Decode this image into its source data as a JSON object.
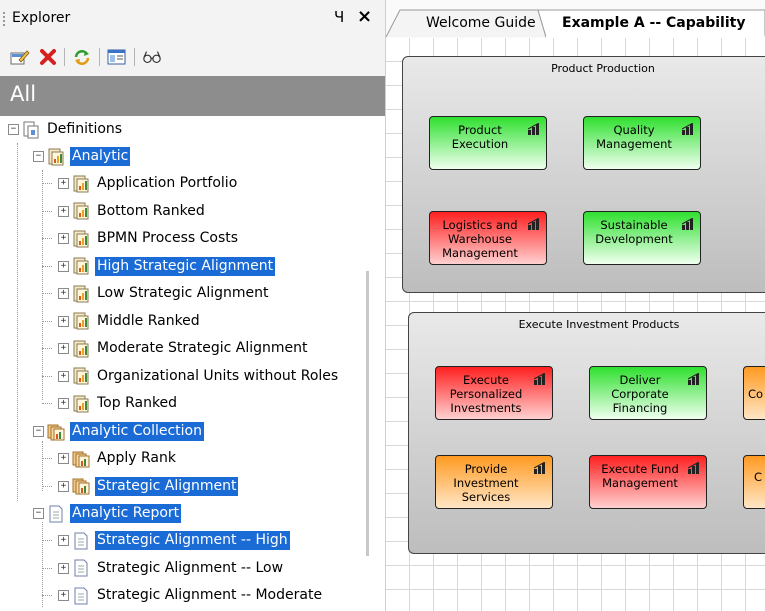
{
  "explorer": {
    "title": "Explorer",
    "pin_glyph": "Ч",
    "close_glyph": "×",
    "toolbar": {
      "items": [
        {
          "name": "edit-icon"
        },
        {
          "name": "delete-icon",
          "color": "#d62020"
        },
        {
          "name": "refresh-icon"
        },
        {
          "name": "properties-icon"
        },
        {
          "name": "glasses-icon"
        }
      ]
    },
    "header": "All",
    "tree": {
      "definitions": "Definitions",
      "analytic": "Analytic",
      "analytic_items": [
        "Application Portfolio",
        "Bottom Ranked",
        "BPMN Process Costs",
        "High Strategic Alignment",
        "Low Strategic Alignment",
        "Middle Ranked",
        "Moderate Strategic Alignment",
        "Organizational Units without Roles",
        "Top Ranked"
      ],
      "analytic_collection": "Analytic Collection",
      "collection_items": [
        "Apply Rank",
        "Strategic Alignment"
      ],
      "analytic_report": "Analytic Report",
      "report_items": [
        "Strategic Alignment -- High",
        "Strategic Alignment -- Low",
        "Strategic Alignment -- Moderate"
      ]
    },
    "selection_color": "#1a6bd6"
  },
  "diagram": {
    "tabs": [
      "Welcome Guide",
      "Example A -- Capability"
    ],
    "groups": [
      {
        "title": "Product Production",
        "capabilities": [
          {
            "label": "Product Execution",
            "status": "green"
          },
          {
            "label": "Quality Management",
            "status": "green"
          },
          {
            "label": "Logistics and Warehouse Management",
            "status": "red"
          },
          {
            "label": "Sustainable Development",
            "status": "green"
          }
        ]
      },
      {
        "title": "Execute Investment Products",
        "capabilities": [
          {
            "label": "Execute Personalized Investments",
            "status": "red"
          },
          {
            "label": "Deliver Corporate Financing",
            "status": "green"
          },
          {
            "label": "Co",
            "status": "orange"
          },
          {
            "label": "Provide Investment Services",
            "status": "orange"
          },
          {
            "label": "Execute Fund Management",
            "status": "red"
          },
          {
            "label": "C In",
            "status": "orange"
          }
        ]
      }
    ],
    "colors": {
      "green": "#2fe02f",
      "red": "#ff2020",
      "orange": "#ff9a22"
    }
  }
}
